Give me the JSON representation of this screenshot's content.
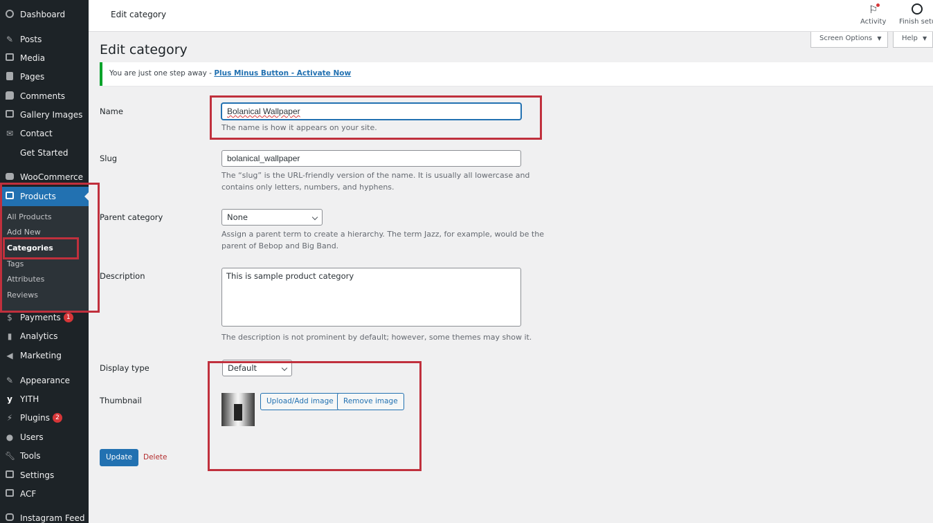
{
  "sidebar": {
    "items": [
      {
        "label": "Dashboard",
        "icon": "dashboard-icon"
      },
      {
        "label": "Posts",
        "icon": "pin-icon"
      },
      {
        "label": "Media",
        "icon": "media-icon"
      },
      {
        "label": "Pages",
        "icon": "pages-icon"
      },
      {
        "label": "Comments",
        "icon": "comments-icon"
      },
      {
        "label": "Gallery Images",
        "icon": "gallery-icon"
      },
      {
        "label": "Contact",
        "icon": "mail-icon"
      },
      {
        "label": "Get Started",
        "icon": ""
      },
      {
        "label": "WooCommerce",
        "icon": "woo-icon"
      },
      {
        "label": "Products",
        "icon": "archive-icon"
      },
      {
        "label": "Payments",
        "icon": "dollar-icon",
        "badge": "1"
      },
      {
        "label": "Analytics",
        "icon": "bar-chart-icon"
      },
      {
        "label": "Marketing",
        "icon": "megaphone-icon"
      },
      {
        "label": "Appearance",
        "icon": "brush-icon"
      },
      {
        "label": "YITH",
        "icon": "yith-icon"
      },
      {
        "label": "Plugins",
        "icon": "plug-icon",
        "badge": "2"
      },
      {
        "label": "Users",
        "icon": "user-icon"
      },
      {
        "label": "Tools",
        "icon": "wrench-icon"
      },
      {
        "label": "Settings",
        "icon": "settings-icon"
      },
      {
        "label": "ACF",
        "icon": "acf-icon"
      },
      {
        "label": "Instagram Feed",
        "icon": "instagram-icon"
      }
    ],
    "submenu": [
      "All Products",
      "Add New",
      "Categories",
      "Tags",
      "Attributes",
      "Reviews"
    ]
  },
  "topbar": {
    "title": "Edit category",
    "activity": "Activity",
    "finish_setup": "Finish setup"
  },
  "tabs": {
    "screen_options": "Screen Options",
    "help": "Help"
  },
  "page": {
    "title": "Edit category",
    "notice_text": "You are just one step away - ",
    "notice_link": "Plus Minus Button - Activate Now"
  },
  "form": {
    "name_label": "Name",
    "name_value": "Bolanical Wallpaper",
    "name_desc": "The name is how it appears on your site.",
    "slug_label": "Slug",
    "slug_value": "bolanical_wallpaper",
    "slug_desc_1": "The “slug” is the URL-friendly version of the name. It is usually all lowercase and",
    "slug_desc_2": "contains only letters, numbers, and hyphens.",
    "parent_label": "Parent category",
    "parent_value": "None",
    "parent_desc_1": "Assign a parent term to create a hierarchy. The term Jazz, for example, would be the",
    "parent_desc_2": "parent of Bebop and Big Band.",
    "description_label": "Description",
    "description_value": "This is sample product category",
    "description_desc": "The description is not prominent by default; however, some themes may show it.",
    "display_label": "Display type",
    "display_value": "Default",
    "thumbnail_label": "Thumbnail",
    "upload_button": "Upload/Add image",
    "remove_button": "Remove image",
    "update_button": "Update",
    "delete_link": "Delete"
  },
  "colors": {
    "sidebar_bg": "#1d2327",
    "accent": "#2271b1",
    "highlight": "#c0303d",
    "badge": "#d63638",
    "notice_border": "#00a32a"
  }
}
